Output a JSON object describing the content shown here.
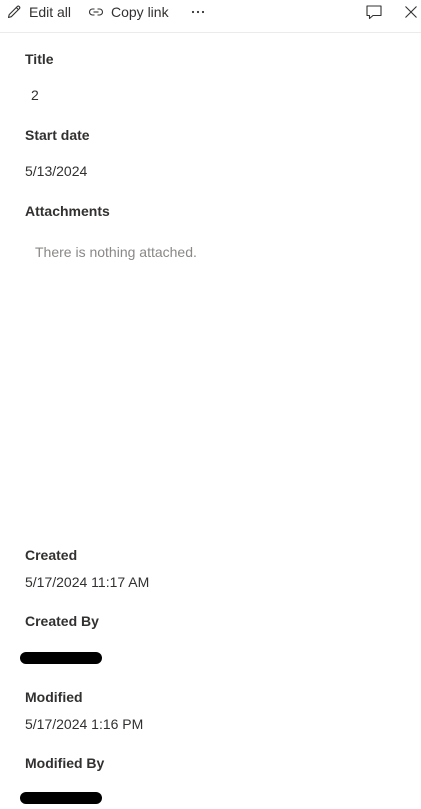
{
  "toolbar": {
    "edit_all_label": "Edit all",
    "copy_link_label": "Copy link",
    "more_label": "···"
  },
  "fields": {
    "title": {
      "label": "Title",
      "value": "2"
    },
    "start_date": {
      "label": "Start date",
      "value": "5/13/2024"
    },
    "attachments": {
      "label": "Attachments",
      "empty_message": "There is nothing attached."
    },
    "created": {
      "label": "Created",
      "value": "5/17/2024 11:17 AM"
    },
    "created_by": {
      "label": "Created By",
      "value_redacted": true
    },
    "modified": {
      "label": "Modified",
      "value": "5/17/2024 1:16 PM"
    },
    "modified_by": {
      "label": "Modified By",
      "value_redacted": true
    }
  },
  "colors": {
    "text": "#323130",
    "muted_text": "#8a8886",
    "accent": "#0078d4",
    "divider": "#edebe9"
  }
}
